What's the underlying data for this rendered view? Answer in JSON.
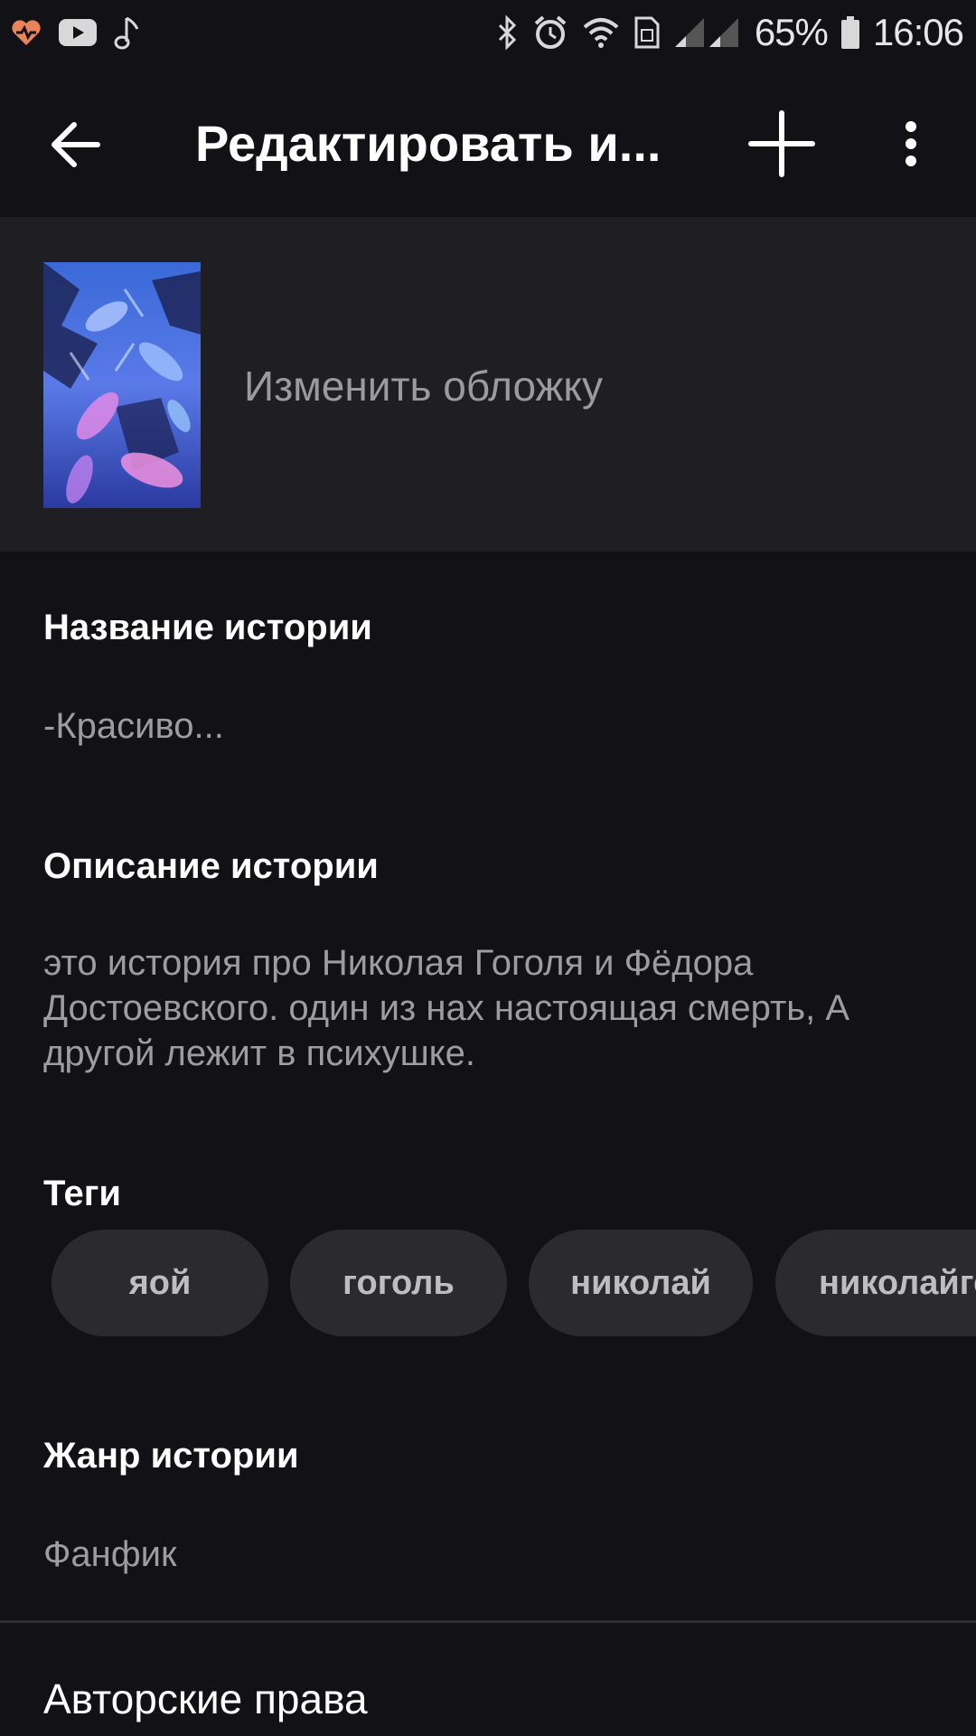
{
  "status_bar": {
    "battery": "65%",
    "time": "16:06",
    "left_icons": [
      "health-heart-icon",
      "youtube-icon",
      "music-note-icon"
    ],
    "right_icons": [
      "bluetooth-icon",
      "alarm-icon",
      "wifi-icon",
      "sim-icon",
      "signal-icon",
      "battery-icon"
    ]
  },
  "app_bar": {
    "title": "Редактировать и...",
    "back_icon": "arrow-left-icon",
    "add_icon": "plus-icon",
    "more_icon": "more-vert-icon"
  },
  "cover": {
    "label": "Изменить обложку"
  },
  "story": {
    "title_heading": "Название истории",
    "title_value": "-Красиво...",
    "description_heading": "Описание истории",
    "description_value": "это история про Николая Гоголя и Фёдора Достоевского. один из нах настоящая смерть, А другой лежит в психушке.",
    "tags_heading": "Теги",
    "tags": [
      "яой",
      "гоголь",
      "николай",
      "николайго"
    ],
    "genre_heading": "Жанр истории",
    "genre_value": "Фанфик",
    "copyright_label": "Авторские права"
  },
  "colors": {
    "background": "#121115",
    "cover_section": "#1f1e23",
    "chip": "#2b2a2f",
    "muted_text": "#9c9ca1"
  }
}
